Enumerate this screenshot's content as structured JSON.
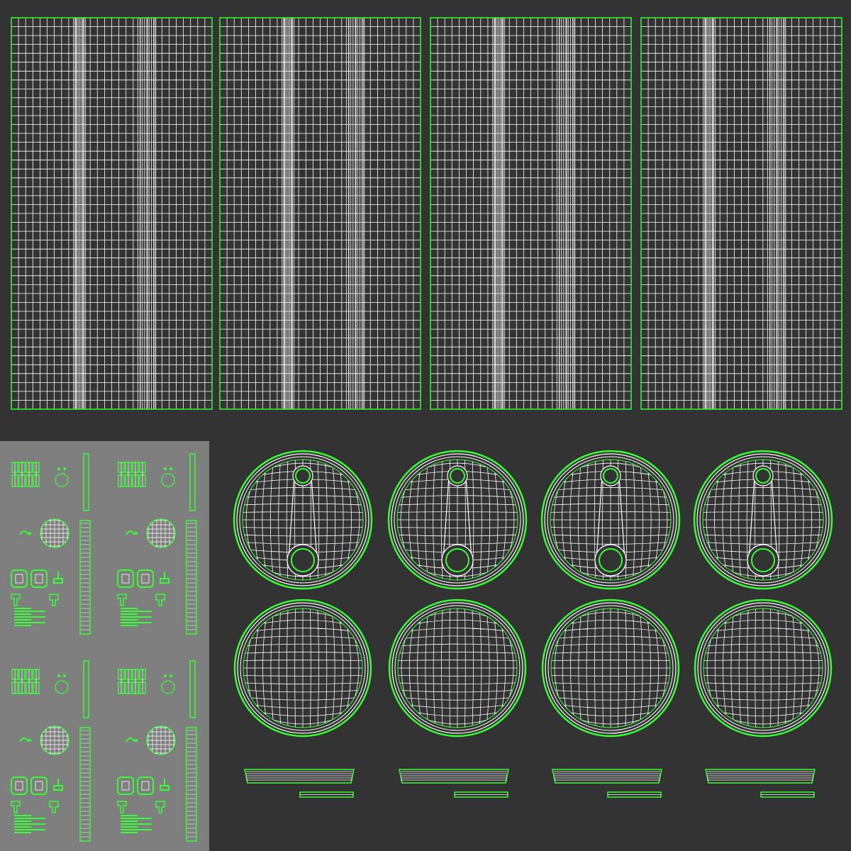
{
  "canvas": {
    "background_color": "#333333",
    "panel_color": "#7f7f7f",
    "wire_color": "#ffffff",
    "seam_color": "#33ff33"
  },
  "icons": {
    "uv_shell": "uv-shell-icon",
    "lid_shell": "lid-shell-icon",
    "rim_strip": "rim-strip-icon"
  }
}
